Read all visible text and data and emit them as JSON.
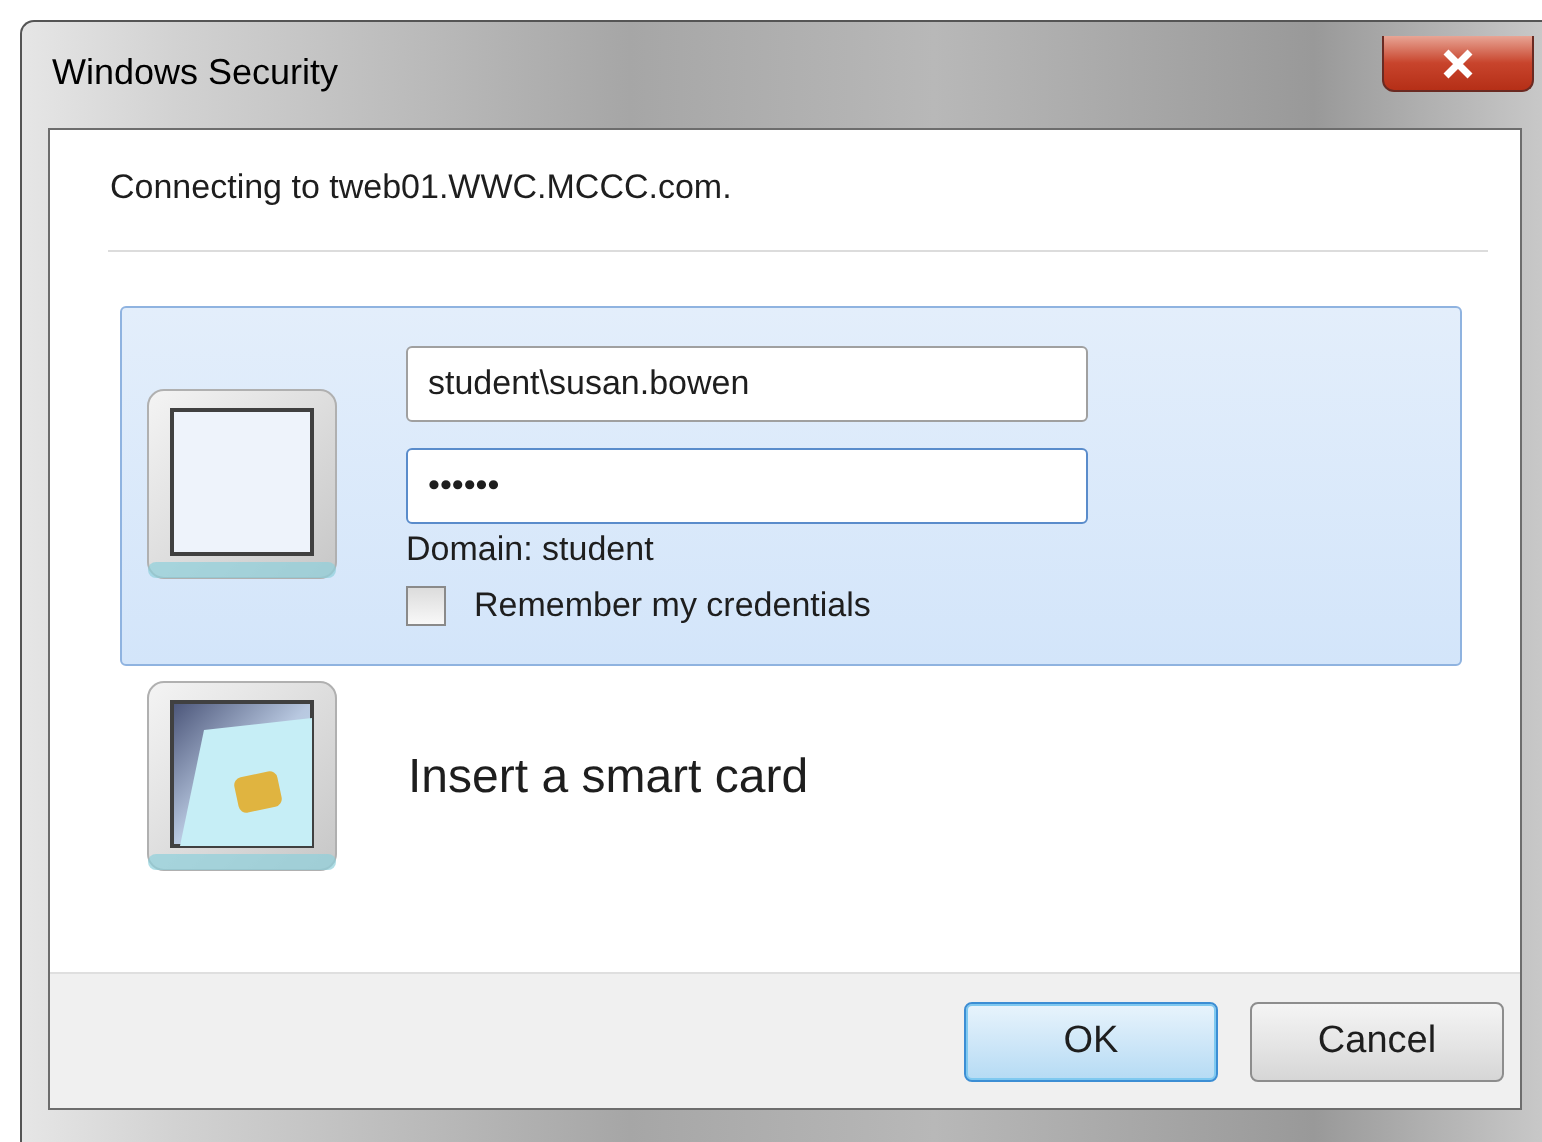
{
  "window": {
    "title": "Windows Security"
  },
  "message": "Connecting to tweb01.WWC.MCCC.com.",
  "credential_tiles": [
    {
      "kind": "password",
      "selected": true,
      "username": "student\\susan.bowen",
      "password": "••••••",
      "domain": "Domain: student",
      "remember": {
        "label": "Remember my credentials",
        "checked": false
      }
    },
    {
      "kind": "smartcard",
      "selected": false,
      "label": "Insert a smart card"
    }
  ],
  "buttons": [
    {
      "label": "OK",
      "default": true
    },
    {
      "label": "Cancel",
      "default": false
    }
  ]
}
